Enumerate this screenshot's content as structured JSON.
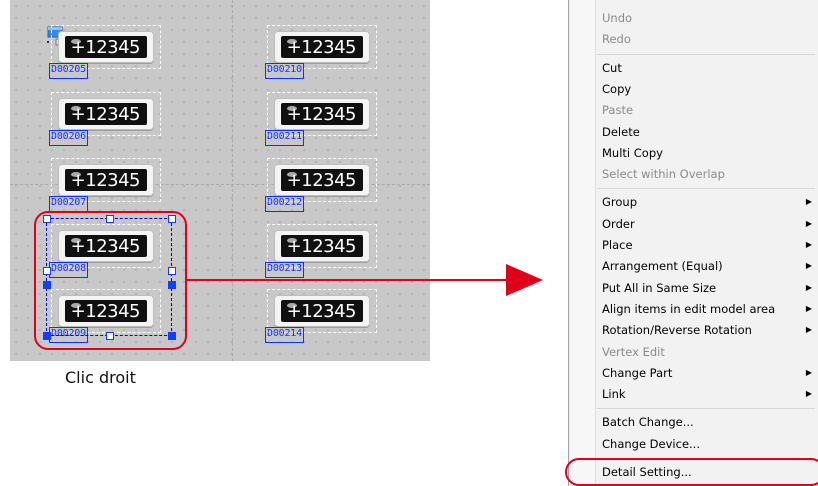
{
  "canvas": {
    "parts": [
      {
        "value": "+12345",
        "address": "D00205"
      },
      {
        "value": "+12345",
        "address": "D00206"
      },
      {
        "value": "+12345",
        "address": "D00207"
      },
      {
        "value": "+12345",
        "address": "D00208"
      },
      {
        "value": "+12345",
        "address": "D00209"
      },
      {
        "value": "+12345",
        "address": "D00210"
      },
      {
        "value": "+12345",
        "address": "D00211"
      },
      {
        "value": "+12345",
        "address": "D00212"
      },
      {
        "value": "+12345",
        "address": "D00213"
      },
      {
        "value": "+12345",
        "address": "D00214"
      }
    ]
  },
  "caption": "Clic droit",
  "context_menu": {
    "groups": [
      [
        {
          "label": "Undo",
          "enabled": false,
          "submenu": false
        },
        {
          "label": "Redo",
          "enabled": false,
          "submenu": false
        }
      ],
      [
        {
          "label": "Cut",
          "enabled": true,
          "submenu": false
        },
        {
          "label": "Copy",
          "enabled": true,
          "submenu": false
        },
        {
          "label": "Paste",
          "enabled": false,
          "submenu": false
        },
        {
          "label": "Delete",
          "enabled": true,
          "submenu": false
        },
        {
          "label": "Multi Copy",
          "enabled": true,
          "submenu": false
        },
        {
          "label": "Select within Overlap",
          "enabled": false,
          "submenu": false
        }
      ],
      [
        {
          "label": "Group",
          "enabled": true,
          "submenu": true
        },
        {
          "label": "Order",
          "enabled": true,
          "submenu": true
        },
        {
          "label": "Place",
          "enabled": true,
          "submenu": true
        },
        {
          "label": "Arrangement (Equal)",
          "enabled": true,
          "submenu": true
        },
        {
          "label": "Put All in Same Size",
          "enabled": true,
          "submenu": true
        },
        {
          "label": "Align items in edit model area",
          "enabled": true,
          "submenu": true
        },
        {
          "label": "Rotation/Reverse Rotation",
          "enabled": true,
          "submenu": true
        },
        {
          "label": "Vertex Edit",
          "enabled": false,
          "submenu": false
        },
        {
          "label": "Change Part",
          "enabled": true,
          "submenu": true
        },
        {
          "label": "Link",
          "enabled": true,
          "submenu": true
        }
      ],
      [
        {
          "label": "Batch Change...",
          "enabled": true,
          "submenu": false
        },
        {
          "label": "Change Device...",
          "enabled": true,
          "submenu": false
        }
      ],
      [
        {
          "label": "Detail Setting...",
          "enabled": true,
          "submenu": false,
          "highlighted": true
        }
      ]
    ]
  },
  "colors": {
    "highlight": "#e1001a",
    "address_blue": "#1030ff",
    "canvas_bg": "#c8c8c8"
  }
}
